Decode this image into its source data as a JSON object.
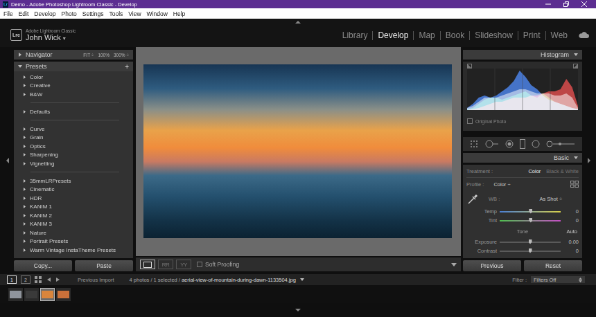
{
  "window": {
    "title": "Demo - Adobe Photoshop Lightroom Classic - Develop",
    "app_icon": "Lr"
  },
  "menu": [
    "File",
    "Edit",
    "Develop",
    "Photo",
    "Settings",
    "Tools",
    "View",
    "Window",
    "Help"
  ],
  "identity": {
    "logo": "Lrc",
    "product": "Adobe Lightroom Classic",
    "user": "John Wick",
    "user_menu": "▾"
  },
  "modules": [
    {
      "label": "Library",
      "selected": false
    },
    {
      "label": "Develop",
      "selected": true
    },
    {
      "label": "Map",
      "selected": false
    },
    {
      "label": "Book",
      "selected": false
    },
    {
      "label": "Slideshow",
      "selected": false
    },
    {
      "label": "Print",
      "selected": false
    },
    {
      "label": "Web",
      "selected": false
    }
  ],
  "navigator": {
    "title": "Navigator",
    "expanded": false,
    "zoom": [
      "FIT ÷",
      "100%",
      "300% ÷"
    ]
  },
  "presets": {
    "title": "Presets",
    "expanded": true,
    "add": "+",
    "groups": [
      [
        {
          "label": "Color",
          "expanded": false
        },
        {
          "label": "Creative",
          "expanded": false
        },
        {
          "label": "B&W",
          "expanded": false
        }
      ],
      [
        {
          "label": "Defaults",
          "expanded": false
        }
      ],
      [
        {
          "label": "Curve",
          "expanded": false
        },
        {
          "label": "Grain",
          "expanded": false
        },
        {
          "label": "Optics",
          "expanded": false
        },
        {
          "label": "Sharpening",
          "expanded": false
        },
        {
          "label": "Vignetting",
          "expanded": false
        }
      ],
      [
        {
          "label": "35mmLRPresets",
          "expanded": false
        },
        {
          "label": "Cinematic",
          "expanded": false
        },
        {
          "label": "HDR",
          "expanded": false
        },
        {
          "label": "KANIM 1",
          "expanded": false
        },
        {
          "label": "KANIM 2",
          "expanded": false
        },
        {
          "label": "KANIM 3",
          "expanded": false
        },
        {
          "label": "Nature",
          "expanded": false
        },
        {
          "label": "Portrait Presets",
          "expanded": false
        },
        {
          "label": "Warm Vintage InstaTheme Presets",
          "expanded": false
        }
      ]
    ]
  },
  "left_buttons": [
    "Copy...",
    "Paste"
  ],
  "toolbar": {
    "view_modes": [
      {
        "kind": "loupe",
        "label": "",
        "selected": true
      },
      {
        "kind": "compare",
        "label": "RR",
        "selected": false
      },
      {
        "kind": "compare",
        "label": "YY",
        "selected": false
      }
    ],
    "soft_proofing": {
      "label": "Soft Proofing",
      "checked": false
    }
  },
  "histogram": {
    "title": "Histogram",
    "expanded": true,
    "series": [
      {
        "name": "luminance",
        "color": "#9a9a9a",
        "values": [
          0.05,
          0.1,
          0.2,
          0.3,
          0.3,
          0.3,
          0.35,
          0.4,
          0.45,
          0.5,
          0.5,
          0.45,
          0.4,
          0.4,
          0.4,
          0.35,
          0.35,
          0.4,
          0.3,
          0.05
        ]
      },
      {
        "name": "red",
        "color": "#d23030",
        "values": [
          0,
          0.02,
          0.05,
          0.1,
          0.15,
          0.2,
          0.2,
          0.25,
          0.3,
          0.3,
          0.3,
          0.35,
          0.35,
          0.4,
          0.45,
          0.45,
          0.5,
          0.75,
          0.55,
          0.1
        ]
      },
      {
        "name": "green",
        "color": "#2fa84a",
        "values": [
          0.02,
          0.05,
          0.15,
          0.25,
          0.3,
          0.3,
          0.25,
          0.3,
          0.35,
          0.4,
          0.45,
          0.35,
          0.3,
          0.4,
          0.3,
          0.2,
          0.15,
          0.1,
          0.05,
          0.02
        ]
      },
      {
        "name": "blue",
        "color": "#2f6fe0",
        "values": [
          0.05,
          0.15,
          0.3,
          0.35,
          0.3,
          0.35,
          0.45,
          0.55,
          0.7,
          0.95,
          0.8,
          0.6,
          0.5,
          0.35,
          0.25,
          0.2,
          0.15,
          0.1,
          0.05,
          0.02
        ]
      }
    ],
    "original_photo": {
      "label": "Original Photo",
      "checked": false
    }
  },
  "basic": {
    "title": "Basic",
    "expanded": true,
    "treatment": {
      "label": "Treatment :",
      "options": [
        {
          "label": "Color",
          "selected": true
        },
        {
          "label": "Black & White",
          "selected": false
        }
      ]
    },
    "profile": {
      "label": "Profile :",
      "value": "Color ÷"
    },
    "wb": {
      "label": "WB :",
      "value": "As Shot ÷"
    },
    "wb_sliders": [
      {
        "label": "Temp",
        "kind": "temp",
        "level": 0.51,
        "reading": "0"
      },
      {
        "label": "Tint",
        "kind": "tint",
        "level": 0.51,
        "reading": "0"
      }
    ],
    "tone": {
      "label": "Tone",
      "auto": "Auto"
    },
    "tone_sliders": [
      {
        "label": "Exposure",
        "kind": "plain",
        "level": 0.5,
        "reading": "0.00"
      },
      {
        "label": "Contrast",
        "kind": "plain",
        "level": 0.5,
        "reading": "0"
      }
    ]
  },
  "right_buttons": [
    "Previous",
    "Reset"
  ],
  "filmstrip": {
    "screens": [
      {
        "label": "1",
        "selected": true
      },
      {
        "label": "2",
        "selected": false
      }
    ],
    "source": "Previous Import",
    "info": "4 photos / 1 selected /",
    "filename": "aerial-view-of-mountain-during-dawn-1133504.jpg",
    "filter_label": "Filter :",
    "filter_value": "Filters Off",
    "thumbnails": [
      {
        "color": "#8f949c",
        "selected": false
      },
      {
        "color": "#3a3a3a",
        "selected": false
      },
      {
        "color": "#d9853c",
        "selected": true
      },
      {
        "color": "#c9703a",
        "selected": false
      }
    ]
  }
}
